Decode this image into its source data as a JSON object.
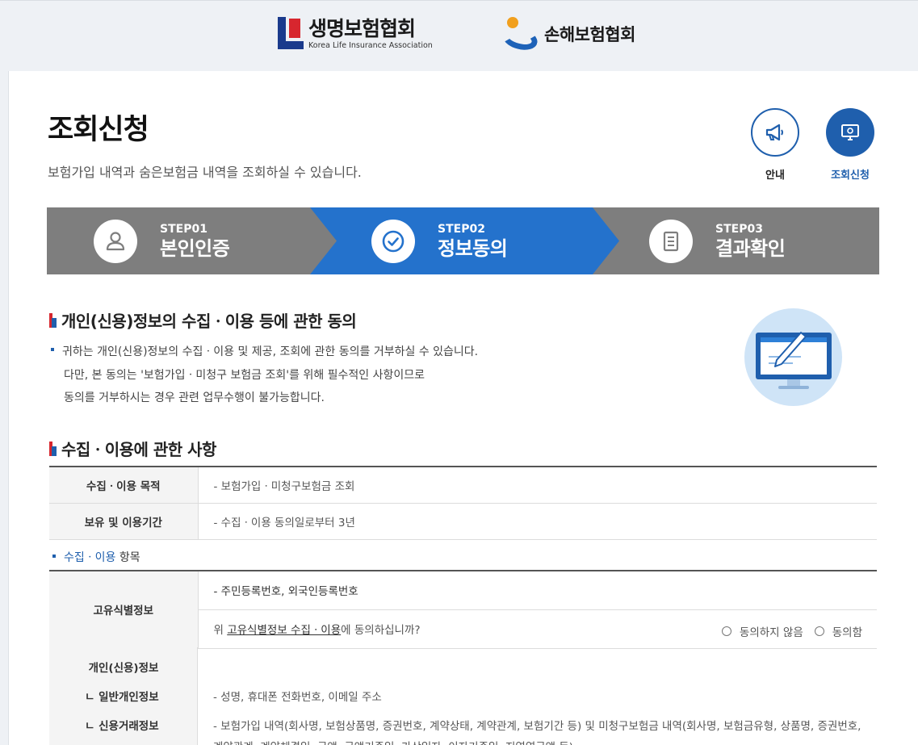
{
  "header": {
    "life_logo_ko": "생명보험협회",
    "life_logo_en": "Korea Life Insurance Association",
    "nonlife_logo_ko": "손해보험협회"
  },
  "page": {
    "title": "조회신청",
    "subtitle": "보험가입 내역과 숨은보험금 내역을 조회하실 수 있습니다.",
    "guide_label": "안내",
    "apply_label": "조회신청"
  },
  "steps": [
    {
      "num": "STEP01",
      "name": "본인인증",
      "icon": "person-icon",
      "active": false
    },
    {
      "num": "STEP02",
      "name": "정보동의",
      "icon": "check-circle-icon",
      "active": true
    },
    {
      "num": "STEP03",
      "name": "결과확인",
      "icon": "document-icon",
      "active": false
    }
  ],
  "consent": {
    "heading": "개인(신용)정보의 수집ㆍ이용 등에 관한 동의",
    "line1": "귀하는 개인(신용)정보의 수집ㆍ이용 및 제공, 조회에 관한 동의를 거부하실 수 있습니다.",
    "line2": "다만, 본 동의는 '보험가입ㆍ미청구 보험금 조회'를 위해 필수적인 사항이므로",
    "line3": "동의를 거부하시는 경우 관련 업무수행이 불가능합니다."
  },
  "collection": {
    "heading": "수집ㆍ이용에 관한 사항",
    "rows": [
      {
        "label": "수집ㆍ이용 목적",
        "value": "- 보험가입ㆍ미청구보험금 조회"
      },
      {
        "label": "보유 및 이용기간",
        "value": "- 수집ㆍ이용 동의일로부터 3년"
      }
    ],
    "items_label_hl": "수집ㆍ이용",
    "items_label_rest": " 항목",
    "unique_id": {
      "label": "고유식별정보",
      "value": "- 주민등록번호, 외국인등록번호",
      "question_prefix": "위 ",
      "question_link": "고유식별정보 수집ㆍ이용",
      "question_suffix": "에 동의하십니까?",
      "disagree": "동의하지 않음",
      "agree": "동의함"
    },
    "personal": {
      "label": "개인(신용)정보",
      "general_label": "ㄴ 일반개인정보",
      "general_value": "- 성명, 휴대폰 전화번호, 이메일 주소",
      "credit_label": "ㄴ 신용거래정보",
      "credit_value": "- 보험가입 내역(회사명, 보험상품명, 증권번호, 계약상태, 계약관계, 보험기간 등) 및 미청구보험금 내역(회사명, 보험금유형, 상품명, 증권번호,",
      "credit_value2": "계약관계, 계약체결일, 금액, 금액기준일, 가상일자, 이자기준일, 지연연금액 등)"
    }
  },
  "colors": {
    "accent_blue": "#2472cc",
    "brand_blue": "#1f5fad",
    "brand_red": "#d7262e",
    "step_gray": "#7e7e7e"
  }
}
